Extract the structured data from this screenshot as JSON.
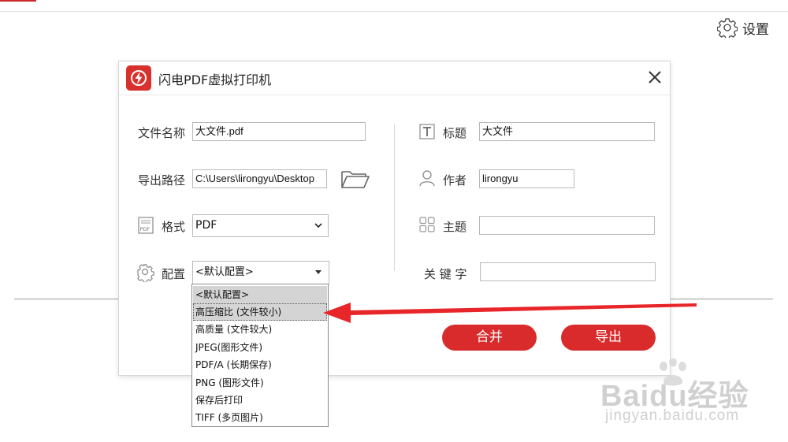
{
  "app": {
    "settings_label": "设置"
  },
  "dialog": {
    "title": "闪电PDF虚拟打印机",
    "left": {
      "filename_label": "文件名称",
      "filename_value": "大文件.pdf",
      "export_path_label": "导出路径",
      "export_path_value": "C:\\Users\\lirongyu\\Desktop",
      "format_label": "格式",
      "format_value": "PDF",
      "config_label": "配置",
      "config_value": "<默认配置>"
    },
    "right": {
      "title_label": "标题",
      "title_value": "大文件",
      "author_label": "作者",
      "author_value": "lirongyu",
      "subject_label": "主题",
      "subject_value": "",
      "keywords_label": "关 键 字",
      "keywords_value": ""
    },
    "merge_button": "合并",
    "export_button": "导出"
  },
  "config_dropdown": {
    "options": [
      "<默认配置>",
      "高压缩比 (文件较小)",
      "高质量 (文件较大)",
      "JPEG(图形文件)",
      "PDF/A (长期保存)",
      "PNG (图形文件)",
      "保存后打印",
      "TIFF (多页图片)"
    ],
    "selected_index": 0,
    "highlighted_index": 1
  },
  "watermark": {
    "main": "Baidu经验",
    "sub": "jingyan.baidu.com"
  },
  "colors": {
    "accent": "#d92b2b",
    "arrow": "#e8262a"
  }
}
